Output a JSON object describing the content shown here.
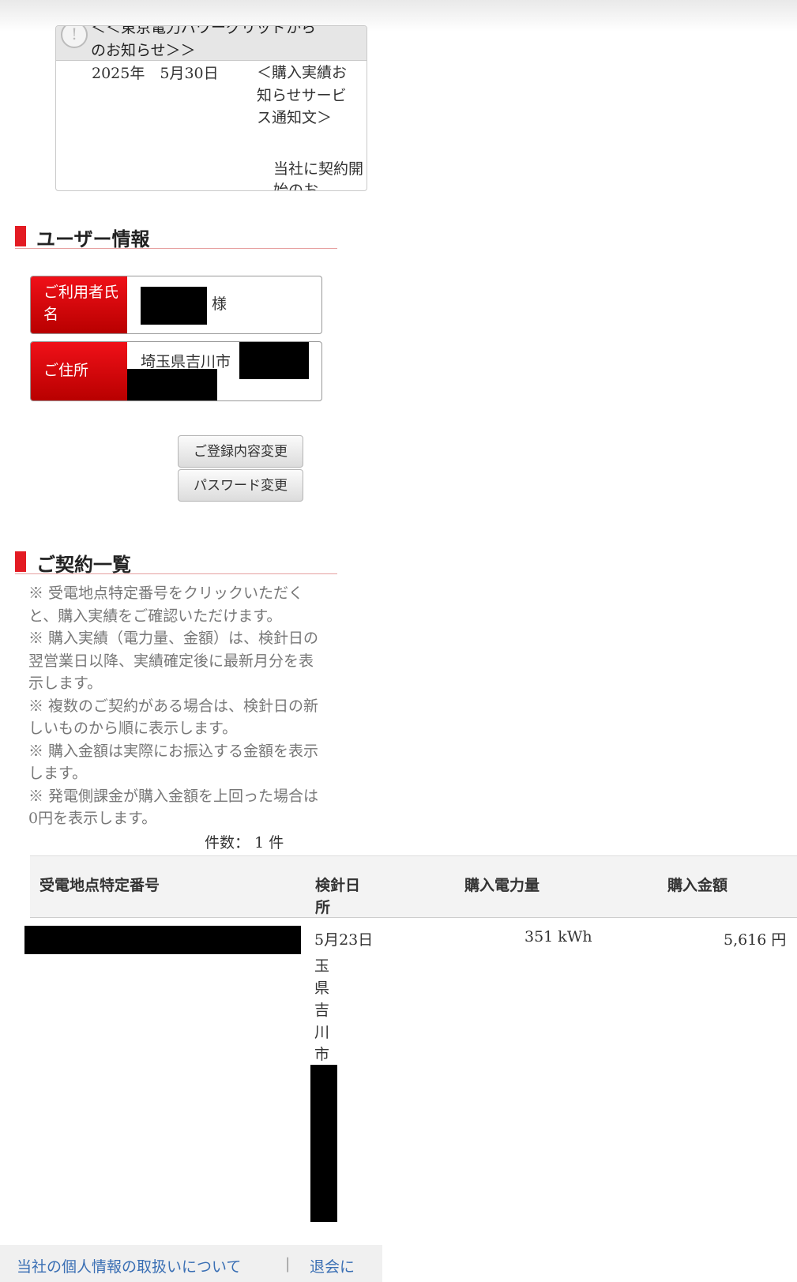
{
  "notice": {
    "title": "＜＜東京電力パワーグリッドからのお知らせ＞＞",
    "date": "2025年　5月30日",
    "body": "＜購入実績お知らせサービス通知文＞",
    "body2": "当社に契約開始のお"
  },
  "user_section": {
    "title": "ユーザー情報",
    "name_label": "ご利用者氏名",
    "name_suffix": "様",
    "address_label": "ご住所",
    "address_value": "埼玉県吉川市",
    "edit_button": "ご登録内容変更",
    "password_button": "パスワード変更"
  },
  "contract_section": {
    "title": "ご契約一覧",
    "notes": [
      "※ 受電地点特定番号をクリックいただくと、購入実績をご確認いただけます。",
      "※ 購入実績（電力量、金額）は、検針日の翌営業日以降、実績確定後に最新月分を表示します。",
      "※ 複数のご契約がある場合は、検針日の新しいものから順に表示します。",
      "※ 購入金額は実際にお振込する金額を表示します。",
      "※ 発電側課金が購入金額を上回った場合は0円を表示します。"
    ],
    "count_label": "件数：",
    "count_value": "1",
    "count_unit": "件",
    "columns": {
      "point_id": "受電地点特定番号",
      "date": "検針日",
      "address": "所",
      "kwh": "購入電力量",
      "amount": "購入金額"
    },
    "row": {
      "date": "5月23日",
      "address_chars": [
        "玉",
        "県",
        "吉",
        "川",
        "市"
      ],
      "kwh": "351 kWh",
      "amount": "5,616 円"
    }
  },
  "footer": {
    "privacy_link": "当社の個人情報の取扱いについて",
    "separator": "|",
    "withdraw_link": "退会に"
  }
}
